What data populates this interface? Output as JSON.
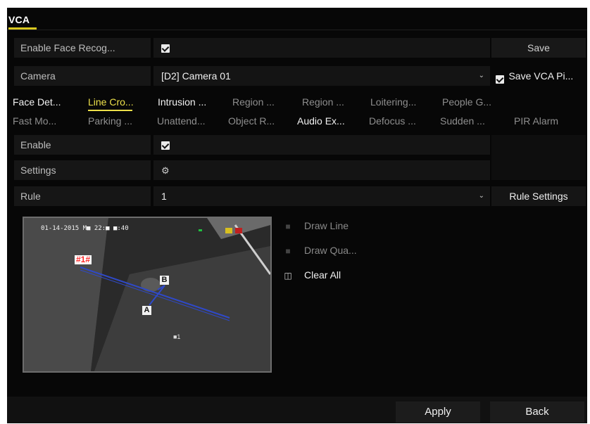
{
  "header": {
    "title": "VCA"
  },
  "form": {
    "enable_face_label": "Enable Face Recog...",
    "camera_label": "Camera",
    "camera_value": "[D2] Camera 01",
    "save_button": "Save",
    "save_vca_label": "Save VCA Pi...",
    "enable_label": "Enable",
    "settings_label": "Settings",
    "rule_label": "Rule",
    "rule_value": "1",
    "rule_settings_button": "Rule Settings"
  },
  "tabs_row1": [
    {
      "label": "Face Det...",
      "state": "bright"
    },
    {
      "label": "Line Cro...",
      "state": "active"
    },
    {
      "label": "Intrusion ...",
      "state": "bright"
    },
    {
      "label": "Region ...",
      "state": "dim"
    },
    {
      "label": "Region ...",
      "state": "dim"
    },
    {
      "label": "Loitering...",
      "state": "dim"
    },
    {
      "label": "People G...",
      "state": "dim"
    }
  ],
  "tabs_row2": [
    {
      "label": "Fast Mo...",
      "state": "dim"
    },
    {
      "label": "Parking ...",
      "state": "dim"
    },
    {
      "label": "Unattend...",
      "state": "dim"
    },
    {
      "label": "Object R...",
      "state": "dim"
    },
    {
      "label": "Audio Ex...",
      "state": "bright"
    },
    {
      "label": "Defocus ...",
      "state": "dim"
    },
    {
      "label": "Sudden ...",
      "state": "dim"
    },
    {
      "label": "PIR Alarm",
      "state": "dim"
    }
  ],
  "preview": {
    "osd_time": "01-14-2015 M■ 22:■ ■:40",
    "rule_tag": "#1#",
    "point_a": "A",
    "point_b": "B",
    "camera_marker": "■1"
  },
  "tools": {
    "draw_line": "Draw Line",
    "draw_quad": "Draw Qua...",
    "clear_all": "Clear All"
  },
  "footer": {
    "apply": "Apply",
    "back": "Back"
  },
  "colors": {
    "accent": "#ede04a",
    "line": "#2f49c8",
    "background": "#070707"
  }
}
